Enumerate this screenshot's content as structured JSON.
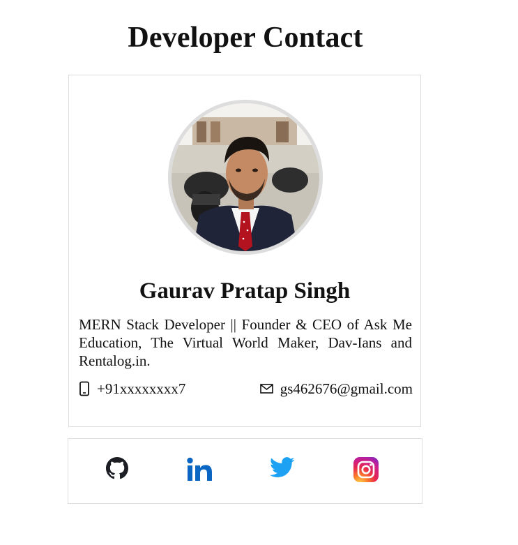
{
  "page": {
    "title": "Developer Contact"
  },
  "profile": {
    "name": "Gaurav Pratap Singh",
    "bio": "MERN Stack Developer || Founder & CEO of Ask Me Education, The Virtual World Maker, Dav-Ians and Rentalog.in.",
    "phone": "+91xxxxxxxx7",
    "email": "gs462676@gmail.com",
    "avatar_icon": "profile-photo"
  },
  "social": [
    {
      "name": "GitHub",
      "icon": "github-icon",
      "color": "#1b1f23"
    },
    {
      "name": "LinkedIn",
      "icon": "linkedin-icon",
      "color": "#0a66c2"
    },
    {
      "name": "Twitter",
      "icon": "twitter-icon",
      "color": "#1da1f2"
    },
    {
      "name": "Instagram",
      "icon": "instagram-icon",
      "color": "#e1306c"
    }
  ],
  "colors": {
    "border": "#dcdcdc",
    "avatar_ring": "#dddddd",
    "text": "#111111"
  }
}
